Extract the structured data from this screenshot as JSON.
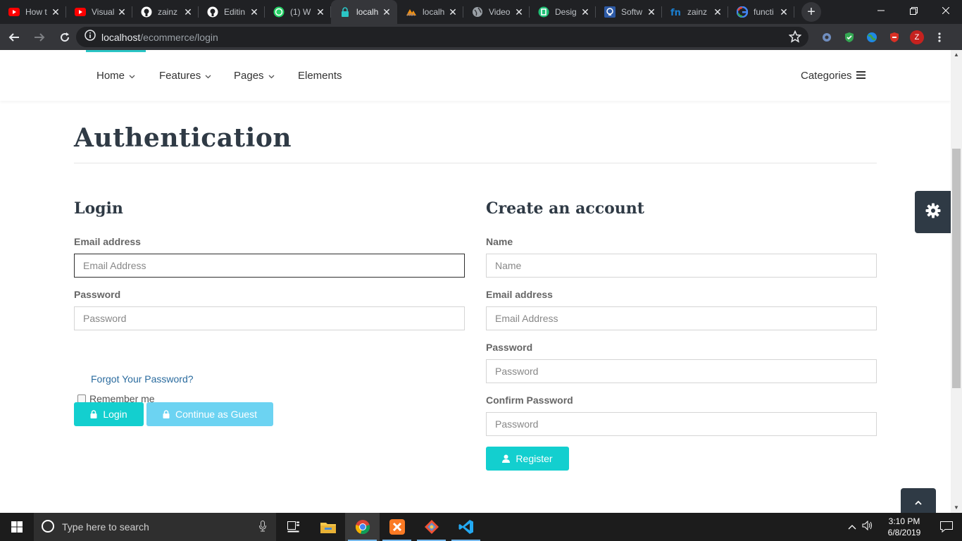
{
  "browser": {
    "tabs": [
      {
        "title": "How t",
        "icon": "youtube-icon",
        "color": "#ff0000"
      },
      {
        "title": "Visual",
        "icon": "youtube-icon",
        "color": "#ff0000"
      },
      {
        "title": "zainz",
        "icon": "github-icon",
        "color": "#ffffff"
      },
      {
        "title": "Editin",
        "icon": "github-icon",
        "color": "#ffffff"
      },
      {
        "title": "(1) W",
        "icon": "whatsapp-icon",
        "color": "#25d366"
      },
      {
        "title": "localh",
        "icon": "lock-icon",
        "color": "#2bc5c5",
        "active": true
      },
      {
        "title": "localh",
        "icon": "phpmyadmin-icon",
        "color": "#f29111"
      },
      {
        "title": "Video",
        "icon": "globe-icon",
        "color": "#9aa0a6"
      },
      {
        "title": "Desig",
        "icon": "design-icon",
        "color": "#1fbf75"
      },
      {
        "title": "Softw",
        "icon": "software-icon",
        "color": "#2d5aa6"
      },
      {
        "title": "zainz",
        "icon": "fiverr-icon",
        "color": "#1a7fd1"
      },
      {
        "title": "functi",
        "icon": "google-icon",
        "color": "#4285f4"
      }
    ],
    "url_host": "localhost",
    "url_path": "/ecommerce/login",
    "profile_initial": "Z"
  },
  "nav": {
    "home": "Home",
    "features": "Features",
    "pages": "Pages",
    "elements": "Elements",
    "categories": "Categories"
  },
  "page_title": "Authentication",
  "login": {
    "heading": "Login",
    "email_label": "Email address",
    "email_placeholder": "Email Address",
    "password_label": "Password",
    "password_placeholder": "Password",
    "remember_label": "Remember me",
    "forgot_link": "Forgot Your Password?",
    "login_button": "Login",
    "guest_button": "Continue as Guest"
  },
  "register": {
    "heading": "Create an account",
    "name_label": "Name",
    "name_placeholder": "Name",
    "email_label": "Email address",
    "email_placeholder": "Email Address",
    "password_label": "Password",
    "password_placeholder": "Password",
    "confirm_label": "Confirm Password",
    "confirm_placeholder": "Password",
    "register_button": "Register"
  },
  "taskbar": {
    "search_placeholder": "Type here to search",
    "time": "3:10 PM",
    "date": "6/8/2019"
  },
  "colors": {
    "accent": "#13cfcf",
    "guest_button": "#6cd3f2",
    "heading": "#2f3a45",
    "link": "#2a6b9e"
  }
}
